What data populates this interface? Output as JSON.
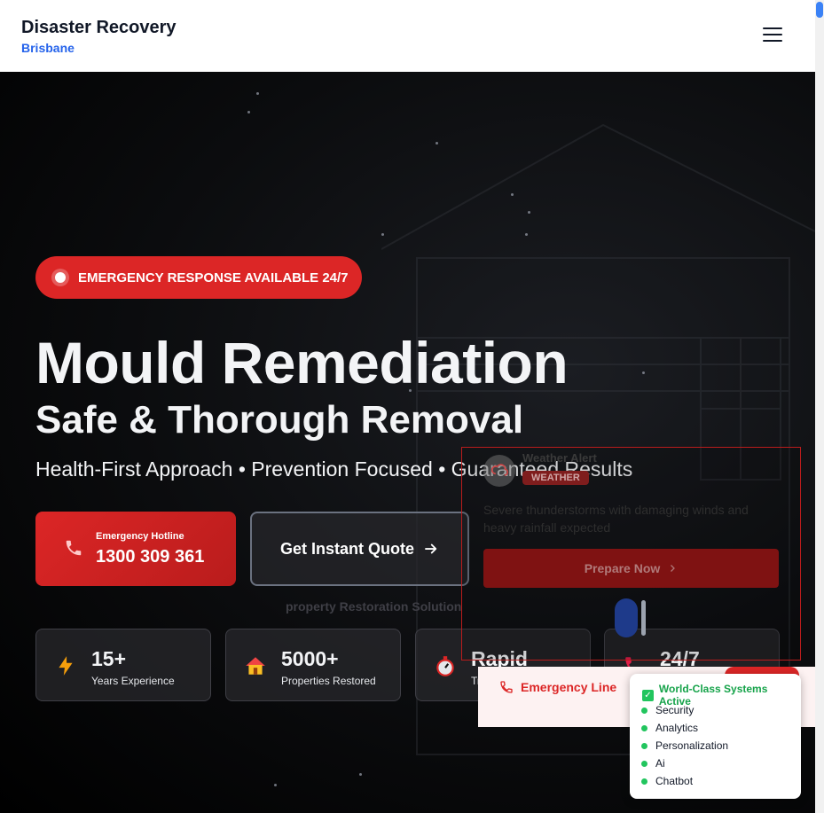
{
  "header": {
    "brand_title": "Disaster Recovery",
    "brand_subtitle": "Brisbane",
    "menu_icon": "hamburger-icon"
  },
  "hero": {
    "badge_text": "EMERGENCY RESPONSE AVAILABLE 24/7",
    "title": "Mould Remediation",
    "subtitle": "Safe & Thorough Removal",
    "tagline": "Health-First Approach • Prevention Focused • Guaranteed Results",
    "hotline": {
      "label": "Emergency Hotline",
      "number": "1300 309 361",
      "icon": "phone-icon"
    },
    "quote_button": {
      "label": "Get Instant Quote",
      "icon": "arrow-right-icon"
    },
    "ghost_text": "property Restoration Solution",
    "stats": [
      {
        "value": "15+",
        "label": "Years Experience",
        "icon": "lightning-icon"
      },
      {
        "value": "5000+",
        "label": "Properties Restored",
        "icon": "house-icon"
      },
      {
        "value": "Rapid",
        "label": "Tr",
        "icon": "stopwatch-icon"
      },
      {
        "value": "24/7",
        "label": "",
        "icon": "phone-icon"
      }
    ]
  },
  "weather_alert": {
    "title": "Weather Alert",
    "tag": "WEATHER",
    "description": "Severe thunderstorms with damaging winds and heavy rainfall expected",
    "button_label": "Prepare Now",
    "icon": "storm-icon"
  },
  "emergency_line": {
    "label": "Emergency Line",
    "icon": "phone-icon"
  },
  "systems_panel": {
    "title": "World-Class Systems Active",
    "items": [
      "Security",
      "Analytics",
      "Personalization",
      "Ai",
      "Chatbot"
    ]
  },
  "colors": {
    "accent_red": "#dc2626",
    "brand_blue": "#2563eb",
    "status_green": "#22c55e"
  }
}
